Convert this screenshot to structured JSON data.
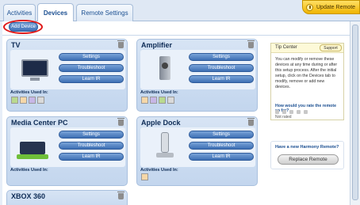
{
  "tabs": [
    {
      "label": "Activities",
      "active": false
    },
    {
      "label": "Devices",
      "active": true
    },
    {
      "label": "Remote Settings",
      "active": false
    }
  ],
  "header": {
    "update_label": "Update Remote"
  },
  "add_device_label": "Add Device",
  "devices": [
    {
      "title": "TV",
      "buttons": [
        "Settings",
        "Troubleshoot",
        "Learn IR"
      ],
      "activities_label": "Activities Used In:",
      "activity_icons": [
        "tv-icon",
        "music-icon",
        "movie-icon",
        "gamepad-icon"
      ]
    },
    {
      "title": "Amplifier",
      "buttons": [
        "Settings",
        "Troubleshoot",
        "Learn IR"
      ],
      "activities_label": "Activities Used In:",
      "activity_icons": [
        "music-icon",
        "movie-icon",
        "tv-icon",
        "gamepad-icon"
      ]
    },
    {
      "title": "Media Center PC",
      "buttons": [
        "Settings",
        "Troubleshoot",
        "Learn IR"
      ],
      "activities_label": "Activities Used In:",
      "activity_icons": []
    },
    {
      "title": "Apple Dock",
      "buttons": [
        "Settings",
        "Troubleshoot",
        "Learn IR"
      ],
      "activities_label": "Activities Used In:",
      "activity_icons": [
        "music-icon"
      ]
    },
    {
      "title": "XBOX 360"
    }
  ],
  "tip_center": {
    "title": "Tip Center",
    "support_label": "Support",
    "text": "You can modify or remove these devices at any time during or after this setup process. After the initial setup, click on the Devices tab to modify, remove or add new devices.",
    "rate_question": "How would you rate the remote so far?",
    "rating_status": "Not rated"
  },
  "harmony": {
    "question": "Have a new Harmony Remote?",
    "button_label": "Replace Remote"
  },
  "colors": {
    "accent": "#3d6fb4",
    "highlight_ring": "#e01818",
    "update_button": "#f0b400"
  }
}
